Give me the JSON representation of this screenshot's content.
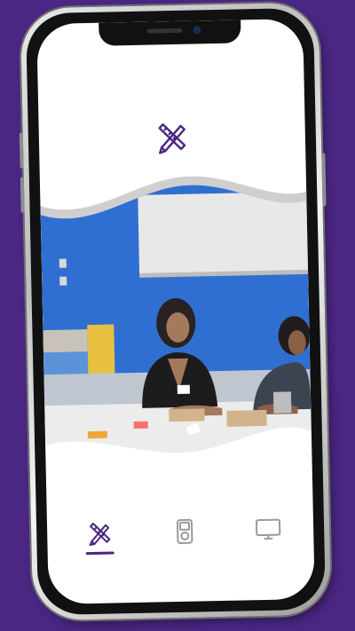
{
  "app": {
    "logo_icon": "pencil-ruler-icon"
  },
  "colors": {
    "background": "#4a2783",
    "accent": "#4a2783",
    "inactive_icon": "#9a9a9a",
    "wave_gray": "#cfcfcf"
  },
  "hero": {
    "image": "classroom-students-writing-photo"
  },
  "tabs": [
    {
      "icon": "pencil-ruler-icon",
      "active": true
    },
    {
      "icon": "ipod-device-icon",
      "active": false
    },
    {
      "icon": "monitor-icon",
      "active": false
    }
  ]
}
